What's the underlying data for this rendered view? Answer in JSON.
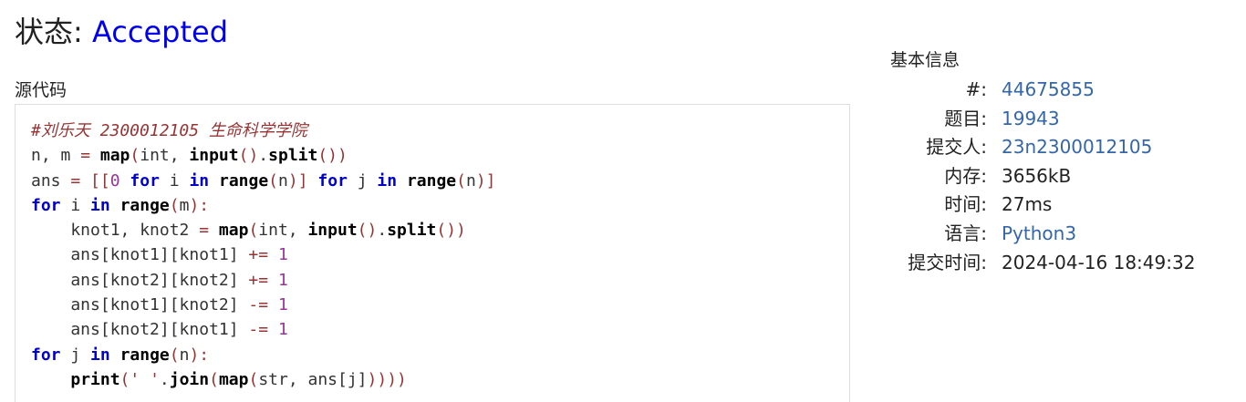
{
  "status": {
    "label": "状态: ",
    "value": "Accepted"
  },
  "source": {
    "label": "源代码",
    "code_lines": [
      [
        {
          "t": "cm",
          "v": "#刘乐天 2300012105 生命科学学院"
        }
      ],
      [
        {
          "t": "id",
          "v": "n, m "
        },
        {
          "t": "op",
          "v": "="
        },
        {
          "t": "id",
          "v": " "
        },
        {
          "t": "bi",
          "v": "map"
        },
        {
          "t": "op",
          "v": "("
        },
        {
          "t": "id",
          "v": "int, "
        },
        {
          "t": "bi",
          "v": "input"
        },
        {
          "t": "op",
          "v": "()"
        },
        {
          "t": "id",
          "v": "."
        },
        {
          "t": "bi",
          "v": "split"
        },
        {
          "t": "op",
          "v": "())"
        }
      ],
      [
        {
          "t": "id",
          "v": "ans "
        },
        {
          "t": "op",
          "v": "="
        },
        {
          "t": "id",
          "v": " "
        },
        {
          "t": "op",
          "v": "[["
        },
        {
          "t": "nm",
          "v": "0"
        },
        {
          "t": "id",
          "v": " "
        },
        {
          "t": "kw",
          "v": "for"
        },
        {
          "t": "id",
          "v": " i "
        },
        {
          "t": "kw",
          "v": "in"
        },
        {
          "t": "id",
          "v": " "
        },
        {
          "t": "bi",
          "v": "range"
        },
        {
          "t": "op",
          "v": "("
        },
        {
          "t": "id",
          "v": "n"
        },
        {
          "t": "op",
          "v": ")]"
        },
        {
          "t": "id",
          "v": " "
        },
        {
          "t": "kw",
          "v": "for"
        },
        {
          "t": "id",
          "v": " j "
        },
        {
          "t": "kw",
          "v": "in"
        },
        {
          "t": "id",
          "v": " "
        },
        {
          "t": "bi",
          "v": "range"
        },
        {
          "t": "op",
          "v": "("
        },
        {
          "t": "id",
          "v": "n"
        },
        {
          "t": "op",
          "v": ")]"
        }
      ],
      [
        {
          "t": "kw",
          "v": "for"
        },
        {
          "t": "id",
          "v": " i "
        },
        {
          "t": "kw",
          "v": "in"
        },
        {
          "t": "id",
          "v": " "
        },
        {
          "t": "bi",
          "v": "range"
        },
        {
          "t": "op",
          "v": "("
        },
        {
          "t": "id",
          "v": "m"
        },
        {
          "t": "op",
          "v": "):"
        }
      ],
      [
        {
          "t": "id",
          "v": "    knot1, knot2 "
        },
        {
          "t": "op",
          "v": "="
        },
        {
          "t": "id",
          "v": " "
        },
        {
          "t": "bi",
          "v": "map"
        },
        {
          "t": "op",
          "v": "("
        },
        {
          "t": "id",
          "v": "int, "
        },
        {
          "t": "bi",
          "v": "input"
        },
        {
          "t": "op",
          "v": "()"
        },
        {
          "t": "id",
          "v": "."
        },
        {
          "t": "bi",
          "v": "split"
        },
        {
          "t": "op",
          "v": "())"
        }
      ],
      [
        {
          "t": "id",
          "v": "    ans[knot1][knot1] "
        },
        {
          "t": "op",
          "v": "+="
        },
        {
          "t": "id",
          "v": " "
        },
        {
          "t": "nm",
          "v": "1"
        }
      ],
      [
        {
          "t": "id",
          "v": "    ans[knot2][knot2] "
        },
        {
          "t": "op",
          "v": "+="
        },
        {
          "t": "id",
          "v": " "
        },
        {
          "t": "nm",
          "v": "1"
        }
      ],
      [
        {
          "t": "id",
          "v": "    ans[knot1][knot2] "
        },
        {
          "t": "op",
          "v": "-="
        },
        {
          "t": "id",
          "v": " "
        },
        {
          "t": "nm",
          "v": "1"
        }
      ],
      [
        {
          "t": "id",
          "v": "    ans[knot2][knot1] "
        },
        {
          "t": "op",
          "v": "-="
        },
        {
          "t": "id",
          "v": " "
        },
        {
          "t": "nm",
          "v": "1"
        }
      ],
      [
        {
          "t": "kw",
          "v": "for"
        },
        {
          "t": "id",
          "v": " j "
        },
        {
          "t": "kw",
          "v": "in"
        },
        {
          "t": "id",
          "v": " "
        },
        {
          "t": "bi",
          "v": "range"
        },
        {
          "t": "op",
          "v": "("
        },
        {
          "t": "id",
          "v": "n"
        },
        {
          "t": "op",
          "v": "):"
        }
      ],
      [
        {
          "t": "id",
          "v": "    "
        },
        {
          "t": "bi",
          "v": "print"
        },
        {
          "t": "op",
          "v": "("
        },
        {
          "t": "st",
          "v": "' '"
        },
        {
          "t": "id",
          "v": "."
        },
        {
          "t": "bi",
          "v": "join"
        },
        {
          "t": "op",
          "v": "("
        },
        {
          "t": "bi",
          "v": "map"
        },
        {
          "t": "op",
          "v": "("
        },
        {
          "t": "id",
          "v": "str, ans[j]"
        },
        {
          "t": "op",
          "v": "))))"
        }
      ]
    ]
  },
  "info": {
    "title": "基本信息",
    "rows": [
      {
        "key": "#:",
        "value": "44675855",
        "link": true
      },
      {
        "key": "题目:",
        "value": "19943",
        "link": true
      },
      {
        "key": "提交人:",
        "value": "23n2300012105",
        "link": true
      },
      {
        "key": "内存:",
        "value": "3656kB",
        "link": false
      },
      {
        "key": "时间:",
        "value": "27ms",
        "link": false
      },
      {
        "key": "语言:",
        "value": "Python3",
        "link": true
      },
      {
        "key": "提交时间:",
        "value": "2024-04-16 18:49:32",
        "link": false
      }
    ]
  },
  "colors": {
    "accepted": "#0000ee",
    "link": "#3366aa",
    "keyword": "#0000cc",
    "comment": "#993333",
    "number": "#993399"
  }
}
